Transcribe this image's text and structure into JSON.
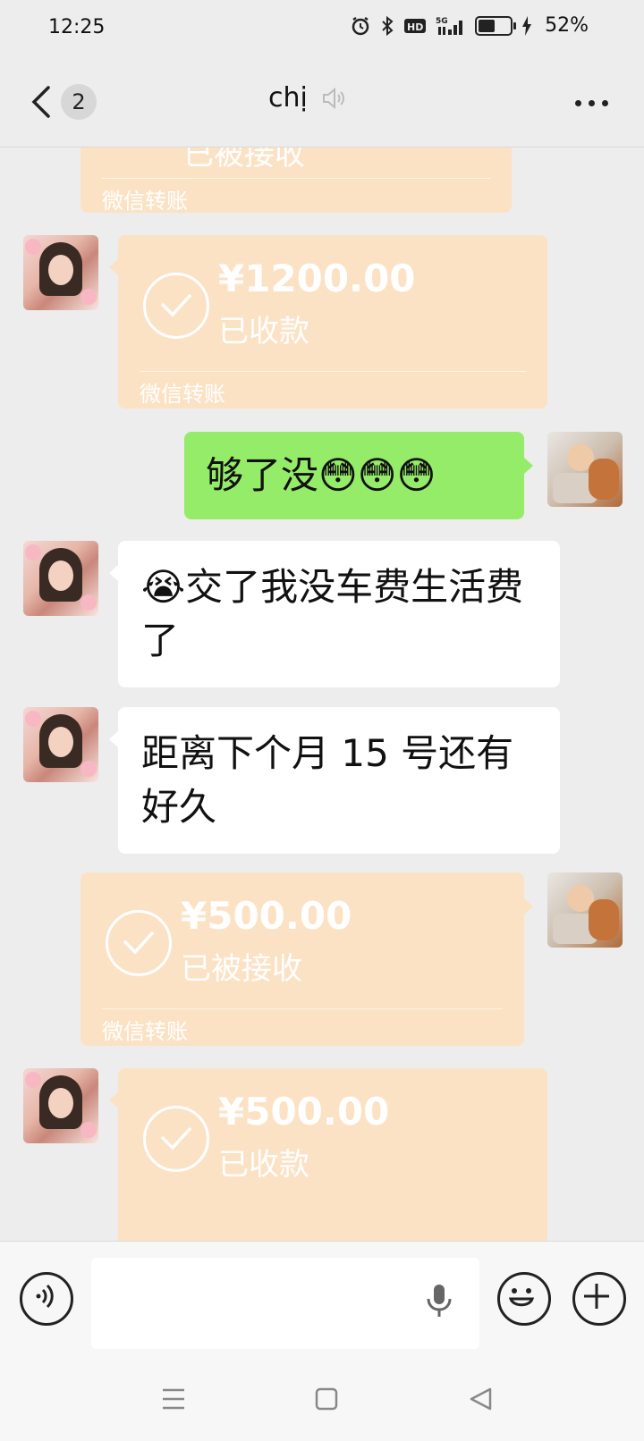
{
  "status_bar": {
    "time": "12:25",
    "battery_percent": "52%",
    "battery_level": 0.52,
    "icons": [
      "alarm-icon",
      "bluetooth-icon",
      "hd-icon",
      "signal-5g-icon",
      "battery-icon",
      "charging-icon"
    ]
  },
  "header": {
    "unread_count": "2",
    "title": "chị",
    "icons": [
      "back-icon",
      "speaker-icon",
      "more-icon"
    ]
  },
  "messages": [
    {
      "type": "transfer",
      "side": "left-partial",
      "status": "已被接收",
      "source": "微信转账"
    },
    {
      "type": "transfer",
      "side": "left",
      "amount": "¥1200.00",
      "status": "已收款",
      "source": "微信转账"
    },
    {
      "type": "text",
      "side": "right",
      "text": "够了没😳😳😳"
    },
    {
      "type": "text",
      "side": "left",
      "text": "😭交了我没车费生活费了"
    },
    {
      "type": "text",
      "side": "left",
      "text": "距离下个月 15 号还有好久"
    },
    {
      "type": "transfer",
      "side": "right",
      "amount": "¥500.00",
      "status": "已被接收",
      "source": "微信转账"
    },
    {
      "type": "transfer",
      "side": "left",
      "amount": "¥500.00",
      "status": "已收款"
    }
  ],
  "input_bar": {
    "value": "",
    "icons": [
      "voice-toggle-icon",
      "microphone-icon",
      "emoji-icon",
      "plus-icon"
    ]
  },
  "system_nav": {
    "icons": [
      "menu-icon",
      "home-icon",
      "back-triangle-icon"
    ]
  },
  "colors": {
    "background": "#ededed",
    "transfer_bubble": "#fce2c4",
    "sent_bubble": "#95ec69",
    "received_bubble": "#ffffff"
  }
}
